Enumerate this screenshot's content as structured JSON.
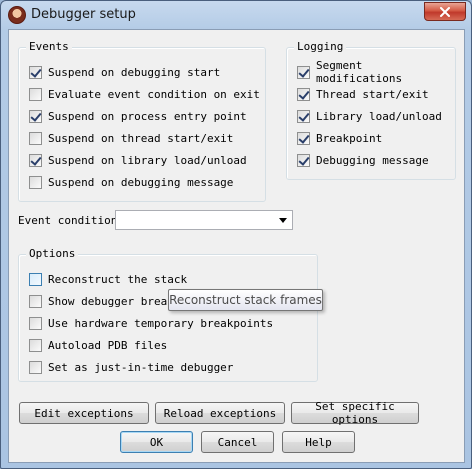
{
  "window": {
    "title": "Debugger setup",
    "icon": "debugger-app-icon",
    "close_icon": "close-icon"
  },
  "events": {
    "title": "Events",
    "items": [
      {
        "label": "Suspend on debugging start",
        "checked": true
      },
      {
        "label": "Evaluate event condition on exit",
        "checked": false
      },
      {
        "label": "Suspend on process entry point",
        "checked": true
      },
      {
        "label": "Suspend on thread start/exit",
        "checked": false
      },
      {
        "label": "Suspend on library load/unload",
        "checked": true
      },
      {
        "label": "Suspend on debugging message",
        "checked": false
      }
    ]
  },
  "logging": {
    "title": "Logging",
    "items": [
      {
        "label": "Segment modifications",
        "checked": true
      },
      {
        "label": "Thread start/exit",
        "checked": true
      },
      {
        "label": "Library load/unload",
        "checked": true
      },
      {
        "label": "Breakpoint",
        "checked": true
      },
      {
        "label": "Debugging message",
        "checked": true
      }
    ]
  },
  "event_condition": {
    "label": "Event condition",
    "value": ""
  },
  "options": {
    "title": "Options",
    "items": [
      {
        "label": "Reconstruct the stack",
        "checked": false
      },
      {
        "label": "Show debugger breakp",
        "checked": false
      },
      {
        "label": "Use hardware temporary breakpoints",
        "checked": false
      },
      {
        "label": "Autoload PDB files",
        "checked": false
      },
      {
        "label": "Set as just-in-time debugger",
        "checked": false
      }
    ]
  },
  "tooltip": {
    "text": "Reconstruct stack frames"
  },
  "buttons": {
    "edit_exceptions": "Edit exceptions",
    "reload_exceptions": "Reload exceptions",
    "set_specific_options": "Set specific options",
    "ok": "OK",
    "cancel": "Cancel",
    "help": "Help"
  }
}
